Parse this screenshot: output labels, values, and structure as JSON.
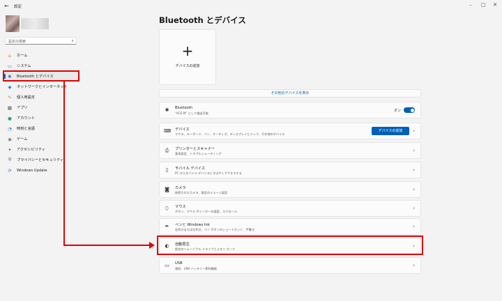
{
  "window": {
    "title": "設定",
    "controls": [
      "–",
      "□",
      "✕"
    ]
  },
  "sidebar": {
    "search_placeholder": "設定の検索",
    "items": [
      {
        "label": "ホーム",
        "icon": "home-icon",
        "glyph": "⌂",
        "color": "#d96b2b"
      },
      {
        "label": "システム",
        "icon": "system-icon",
        "glyph": "▭",
        "color": "#2b79d0"
      },
      {
        "label": "Bluetooth とデバイス",
        "icon": "bluetooth-icon",
        "glyph": "✱",
        "color": "#2b79d0"
      },
      {
        "label": "ネットワークとインターネット",
        "icon": "network-icon",
        "glyph": "◆",
        "color": "#3a7fd6"
      },
      {
        "label": "個人用設定",
        "icon": "personalization-icon",
        "glyph": "✎",
        "color": "#d9862b"
      },
      {
        "label": "アプリ",
        "icon": "apps-icon",
        "glyph": "▦",
        "color": "#555555"
      },
      {
        "label": "アカウント",
        "icon": "account-icon",
        "glyph": "●",
        "color": "#2fa06a"
      },
      {
        "label": "時刻と言語",
        "icon": "time-language-icon",
        "glyph": "◔",
        "color": "#2b79d0"
      },
      {
        "label": "ゲーム",
        "icon": "gaming-icon",
        "glyph": "◉",
        "color": "#777777"
      },
      {
        "label": "アクセシビリティ",
        "icon": "accessibility-icon",
        "glyph": "✦",
        "color": "#2b79d0"
      },
      {
        "label": "プライバシーとセキュリティ",
        "icon": "privacy-icon",
        "glyph": "⛨",
        "color": "#666666"
      },
      {
        "label": "Windows Update",
        "icon": "windows-update-icon",
        "glyph": "⟳",
        "color": "#2b79d0"
      }
    ],
    "selected_index": 2
  },
  "main": {
    "page_title": "Bluetooth とデバイス",
    "add_device_label": "デバイスの追加",
    "more_devices_link": "その他のデバイスを表示",
    "bluetooth": {
      "title": "Bluetooth",
      "subtitle": "\"ACE-M\" として検出可能",
      "toggle_label": "オン"
    },
    "rows": [
      {
        "title": "デバイス",
        "subtitle": "マウス、キーボード、ペン、オーディオ、ディスプレイとドック、その他のデバイス",
        "icon": "devices-icon",
        "glyph": "⌨",
        "button": "デバイスの追加"
      },
      {
        "title": "プリンターとスキャナー",
        "subtitle": "基本設定、トラブルシューティング",
        "icon": "printer-icon",
        "glyph": "⎙"
      },
      {
        "title": "モバイル デバイス",
        "subtitle": "PC からモバイル デバイスにすばやくアクセスする",
        "icon": "mobile-icon",
        "glyph": "▯"
      },
      {
        "title": "カメラ",
        "subtitle": "接続されたカメラ、既定のイメージ設定",
        "icon": "camera-icon",
        "glyph": "◙"
      },
      {
        "title": "マウス",
        "subtitle": "ボタン、マウス ポインターの速度、スクロール",
        "icon": "mouse-icon",
        "glyph": "⬯"
      },
      {
        "title": "ペンと Windows Ink",
        "subtitle": "右利きまたは左利き、ペン ボタンのショートカット、手書き",
        "icon": "pen-icon",
        "glyph": "✒"
      },
      {
        "title": "自動再生",
        "subtitle": "既定のリムーバブル ドライブとメモリ カード",
        "icon": "autoplay-icon",
        "glyph": "◐"
      },
      {
        "title": "USB",
        "subtitle": "通知、USB バッテリー節約機能",
        "icon": "usb-icon",
        "glyph": "▭"
      }
    ]
  },
  "annotation_color": "#e00000"
}
